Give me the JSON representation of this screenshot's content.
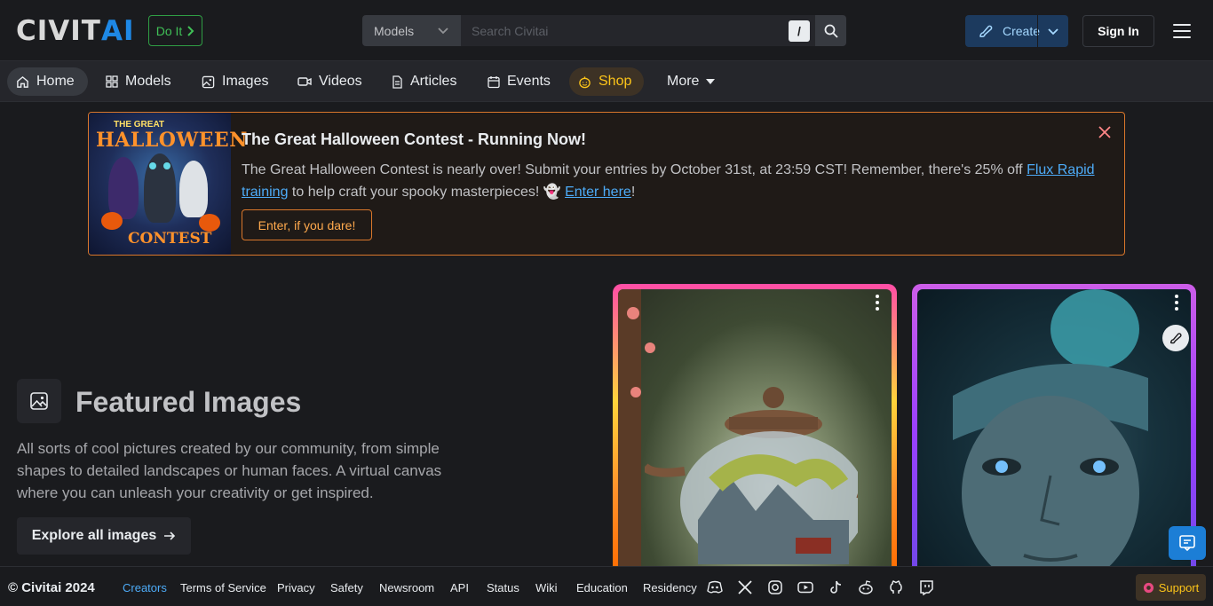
{
  "header": {
    "logo_main": "CIVIT",
    "logo_accent": "AI",
    "doit_label": "Do It",
    "search_category": "Models",
    "search_placeholder": "Search Civitai",
    "search_shortcut": "/",
    "create_label": "Create",
    "signin_label": "Sign In"
  },
  "nav": {
    "items": [
      {
        "label": "Home",
        "icon": "home-icon"
      },
      {
        "label": "Models",
        "icon": "grid-icon"
      },
      {
        "label": "Images",
        "icon": "image-icon"
      },
      {
        "label": "Videos",
        "icon": "video-icon"
      },
      {
        "label": "Articles",
        "icon": "file-icon"
      },
      {
        "label": "Events",
        "icon": "calendar-icon"
      },
      {
        "label": "Shop",
        "icon": "pumpkin-icon"
      },
      {
        "label": "More",
        "icon": "caret-down-icon"
      }
    ]
  },
  "banner": {
    "image_line1": "THE GREAT",
    "image_line2": "HALLOWEEN",
    "image_line3": "CONTEST",
    "title": "The Great Halloween Contest - Running Now!",
    "text_part1": "The Great Halloween Contest is nearly over! Submit your entries by October 31st, at 23:59 CST! Remember, there's 25% off ",
    "link1": "Flux Rapid training",
    "text_part2": " to help craft your spooky masterpieces! 👻 ",
    "link2": "Enter here",
    "text_part3": "!",
    "button": "Enter, if you dare!"
  },
  "featured": {
    "title": "Featured Images",
    "description": "All sorts of cool pictures created by our community, from simple shapes to detailed landscapes or human faces. A virtual canvas where you can unleash your creativity or get inspired.",
    "explore_label": "Explore all images"
  },
  "footer": {
    "copyright": "© Civitai 2024",
    "links": [
      "Creators",
      "Terms of Service",
      "Privacy",
      "Safety",
      "Newsroom",
      "API",
      "Status",
      "Wiki",
      "Education",
      "Residency"
    ],
    "social": [
      "discord-icon",
      "x-icon",
      "instagram-icon",
      "youtube-icon",
      "tiktok-icon",
      "reddit-icon",
      "github-icon",
      "twitch-icon"
    ],
    "support_label": "Support"
  },
  "colors": {
    "accent": "#1e88e5",
    "banner_border": "#d9772b",
    "link": "#4dabf7"
  }
}
